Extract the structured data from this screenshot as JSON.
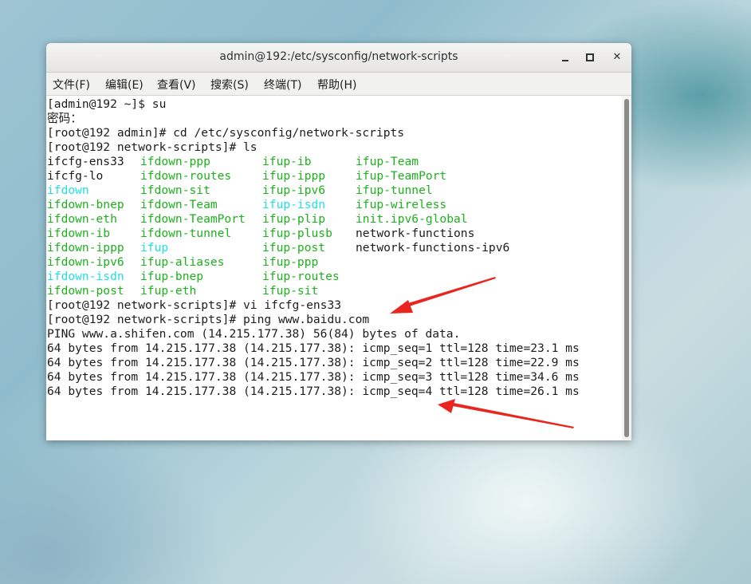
{
  "window": {
    "title": "admin@192:/etc/sysconfig/network-scripts",
    "buttons": {
      "minimize_icon": "minimize-icon",
      "maximize_icon": "maximize-icon",
      "close_label": "✕"
    }
  },
  "menu": [
    "文件(F)",
    "编辑(E)",
    "查看(V)",
    "搜索(S)",
    "终端(T)",
    "帮助(H)"
  ],
  "terminal": {
    "lines": [
      "[admin@192 ~]$ su",
      "密码：",
      "[root@192 admin]# cd /etc/sysconfig/network-scripts",
      "[root@192 network-scripts]# ls"
    ],
    "ls_rows": [
      [
        "ifcfg-ens33",
        "ifdown-ppp",
        "ifup-ib",
        "ifup-Team"
      ],
      [
        "ifcfg-lo",
        "ifdown-routes",
        "ifup-ippp",
        "ifup-TeamPort"
      ],
      [
        "ifdown",
        "ifdown-sit",
        "ifup-ipv6",
        "ifup-tunnel"
      ],
      [
        "ifdown-bnep",
        "ifdown-Team",
        "ifup-isdn",
        "ifup-wireless"
      ],
      [
        "ifdown-eth",
        "ifdown-TeamPort",
        "ifup-plip",
        "init.ipv6-global"
      ],
      [
        "ifdown-ib",
        "ifdown-tunnel",
        "ifup-plusb",
        "network-functions"
      ],
      [
        "ifdown-ippp",
        "ifup",
        "ifup-post",
        "network-functions-ipv6"
      ],
      [
        "ifdown-ipv6",
        "ifup-aliases",
        "ifup-ppp",
        ""
      ],
      [
        "ifdown-isdn",
        "ifup-bnep",
        "ifup-routes",
        ""
      ],
      [
        "ifdown-post",
        "ifup-eth",
        "ifup-sit",
        ""
      ]
    ],
    "ls_colors": [
      [
        "default",
        "green",
        "green",
        "green"
      ],
      [
        "default",
        "green",
        "green",
        "green"
      ],
      [
        "cyan",
        "green",
        "green",
        "green"
      ],
      [
        "green",
        "green",
        "cyan",
        "green"
      ],
      [
        "green",
        "green",
        "green",
        "green"
      ],
      [
        "green",
        "green",
        "green",
        "default"
      ],
      [
        "green",
        "cyan",
        "green",
        "default"
      ],
      [
        "green",
        "green",
        "green",
        "default"
      ],
      [
        "cyan",
        "green",
        "green",
        "default"
      ],
      [
        "green",
        "green",
        "green",
        "default"
      ]
    ],
    "after_lines": [
      "[root@192 network-scripts]# vi ifcfg-ens33",
      "[root@192 network-scripts]# ping www.baidu.com",
      "PING www.a.shifen.com (14.215.177.38) 56(84) bytes of data.",
      "64 bytes from 14.215.177.38 (14.215.177.38): icmp_seq=1 ttl=128 time=23.1 ms",
      "64 bytes from 14.215.177.38 (14.215.177.38): icmp_seq=2 ttl=128 time=22.9 ms",
      "64 bytes from 14.215.177.38 (14.215.177.38): icmp_seq=3 ttl=128 time=34.6 ms",
      "64 bytes from 14.215.177.38 (14.215.177.38): icmp_seq=4 ttl=128 time=26.1 ms"
    ]
  },
  "colors": {
    "ls_green": "#1db11d",
    "ls_cyan": "#1fdfe6",
    "annotation_arrow": "#e8261f"
  }
}
